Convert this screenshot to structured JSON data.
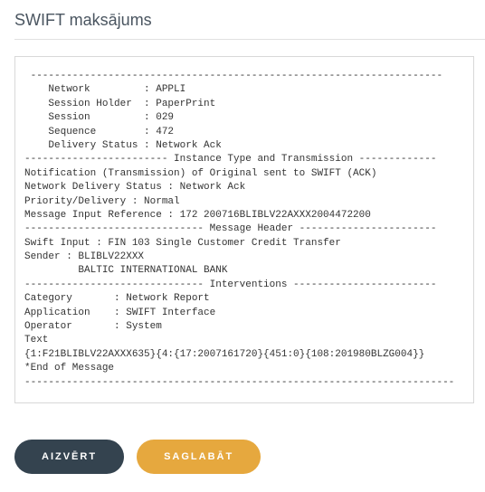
{
  "title": "SWIFT maksājums",
  "message_body": " ---------------------------------------------------------------------\n    Network         : APPLI\n    Session Holder  : PaperPrint\n    Session         : 029\n    Sequence        : 472\n    Delivery Status : Network Ack\n------------------------ Instance Type and Transmission -------------\nNotification (Transmission) of Original sent to SWIFT (ACK)\nNetwork Delivery Status : Network Ack\nPriority/Delivery : Normal\nMessage Input Reference : 172 200716BLIBLV22AXXX2004472200\n------------------------------ Message Header -----------------------\nSwift Input : FIN 103 Single Customer Credit Transfer\nSender : BLIBLV22XXX\n         BALTIC INTERNATIONAL BANK\n------------------------------ Interventions ------------------------\nCategory       : Network Report\nApplication    : SWIFT Interface\nOperator       : System\nText\n{1:F21BLIBLV22AXXX635}{4:{17:2007161720}{451:0}{108:201980BLZG004}}\n*End of Message\n------------------------------------------------------------------------",
  "buttons": {
    "close": "AIZVĒRT",
    "save": "SAGLABĀT"
  }
}
